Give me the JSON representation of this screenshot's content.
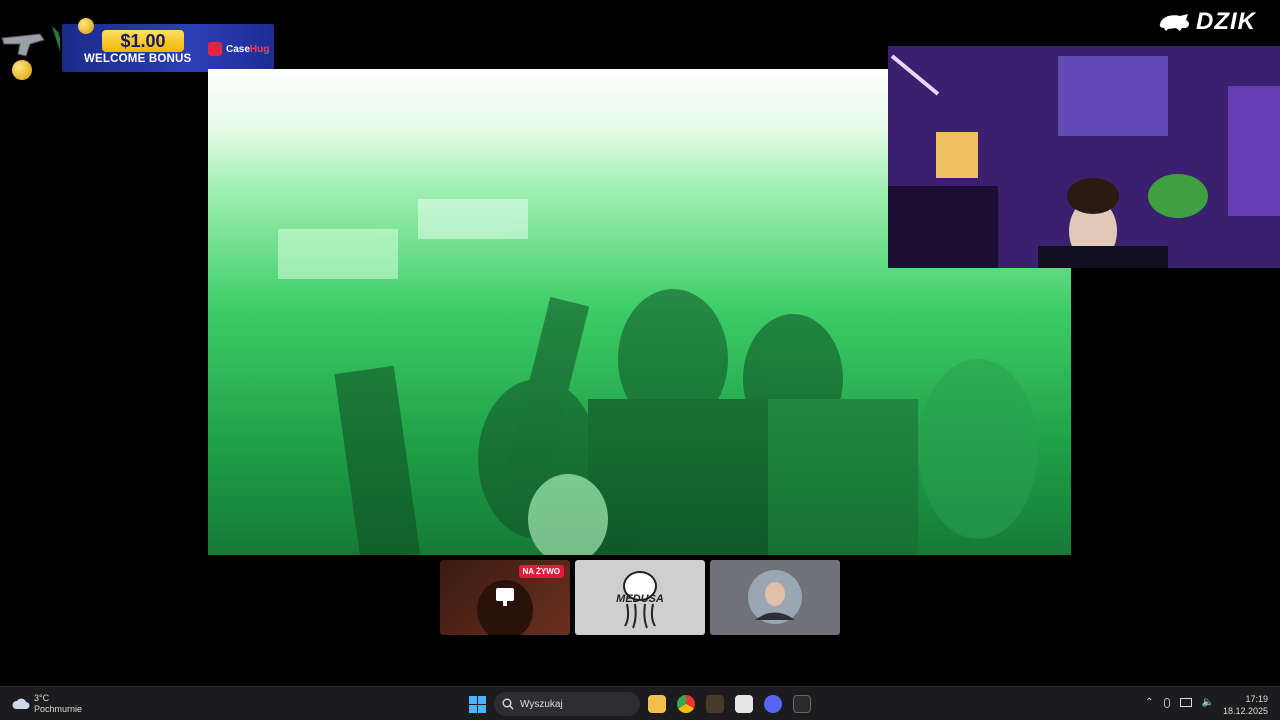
{
  "promo": {
    "amount": "$1.00",
    "bonus_text": "WELCOME BONUS",
    "brand_prefix": "Case",
    "brand_suffix": "Hug"
  },
  "channel_logo": {
    "text": "DZIK",
    "icon": "boar-icon"
  },
  "thumbnails": [
    {
      "badge": "NA ŻYWO",
      "icon": "screen-share-icon"
    },
    {
      "label": "MEDUSA"
    },
    {
      "icon": "avatar"
    }
  ],
  "taskbar": {
    "weather_temp": "3°C",
    "weather_desc": "Pochmurnie",
    "search_placeholder": "Wyszukaj",
    "time": "17:19",
    "date": "18.12.2025",
    "apps": [
      "file-explorer-icon",
      "chrome-icon",
      "app-icon",
      "app-icon",
      "discord-icon",
      "epic-games-icon"
    ]
  },
  "colors": {
    "accent_blue": "#4cb4ff",
    "live_red": "#e5193a",
    "promo_blue": "#2c3fb5",
    "promo_gold": "#f4b400"
  }
}
